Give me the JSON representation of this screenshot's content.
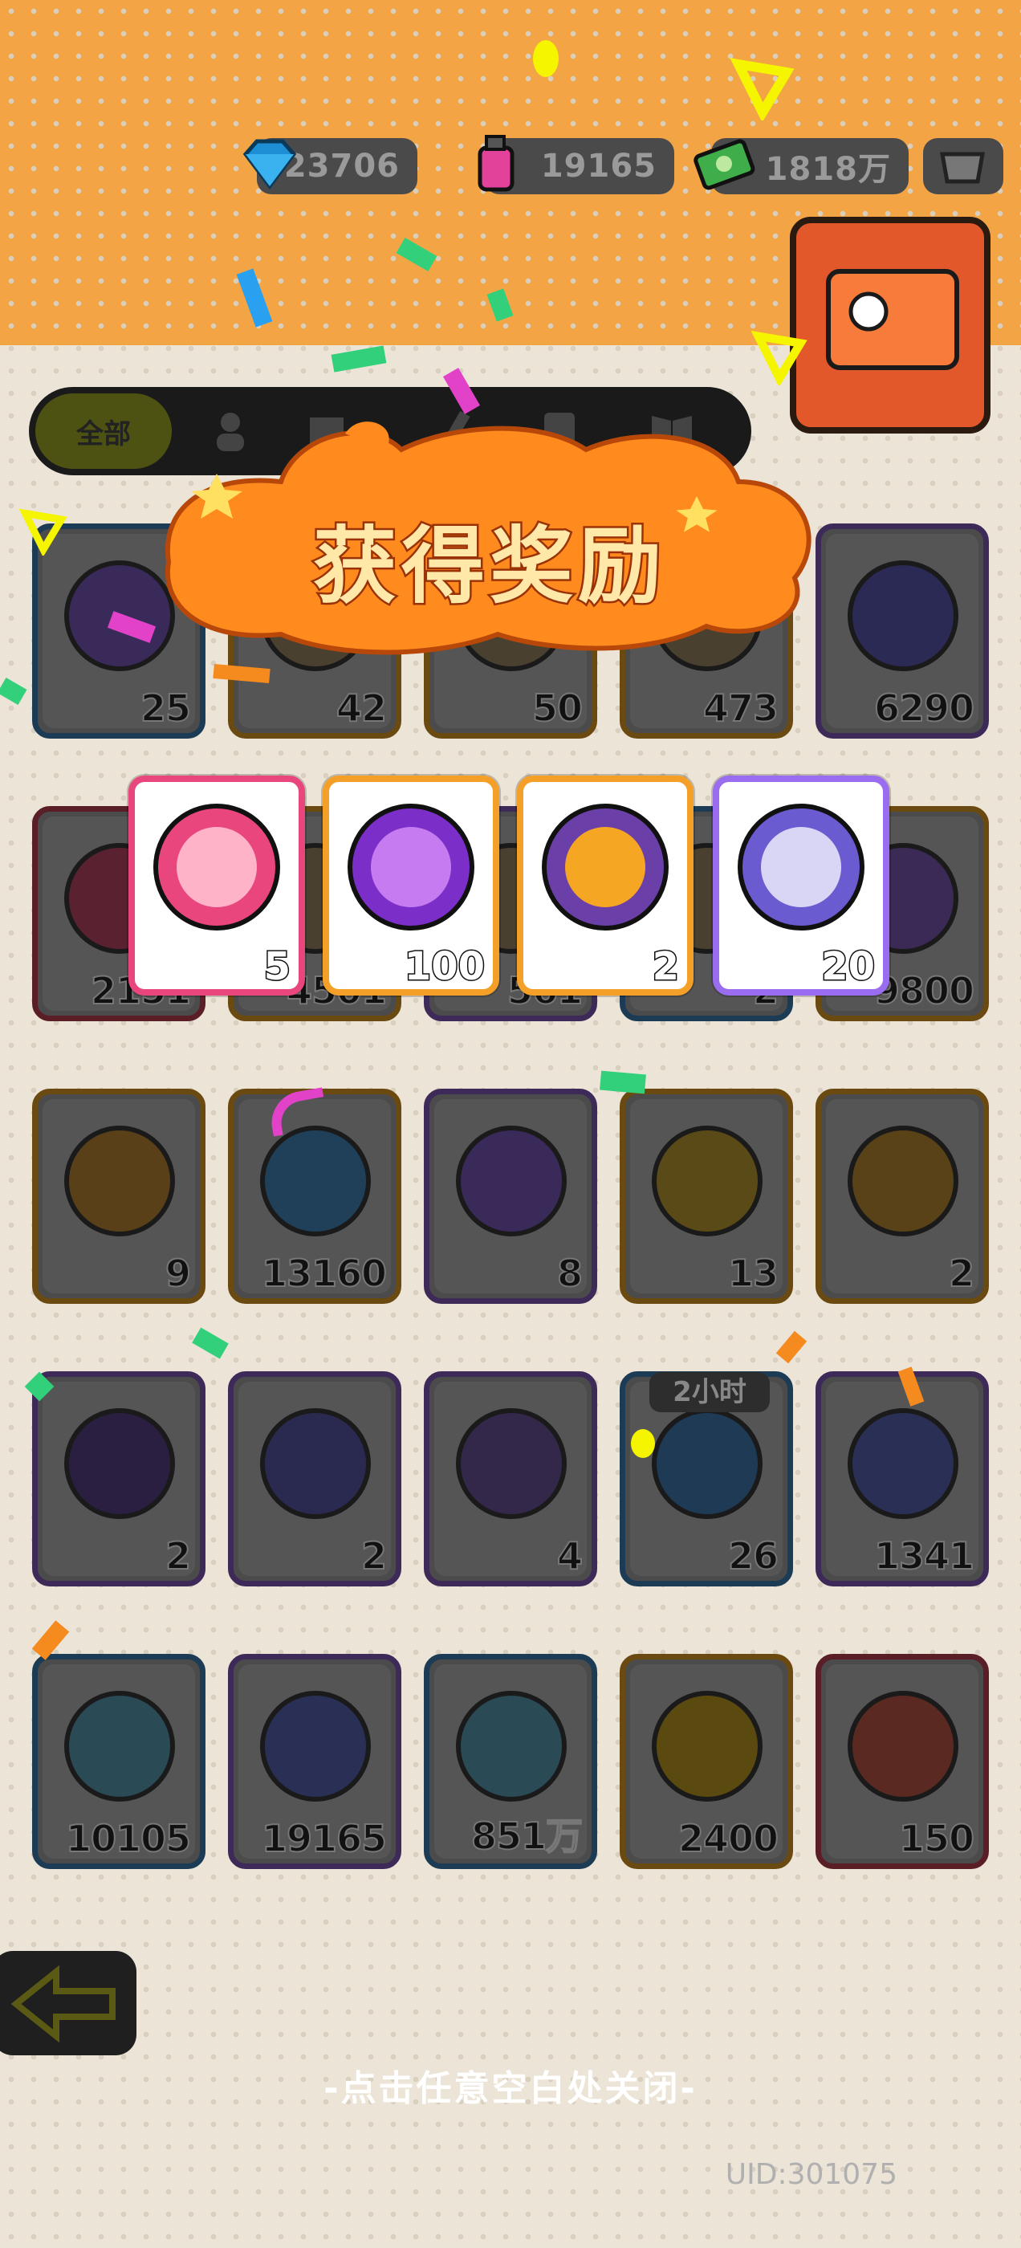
{
  "currencies": [
    {
      "icon": "diamond-icon",
      "value": "23706"
    },
    {
      "icon": "spray-can-icon",
      "value": "19165"
    },
    {
      "icon": "cash-icon",
      "value": "1818万"
    }
  ],
  "tabs": {
    "active_label": "全部"
  },
  "inventory": [
    {
      "icon": "ticket-icon",
      "count": "25",
      "border": "blue"
    },
    {
      "icon": "item-icon",
      "count": "42",
      "border": "orange"
    },
    {
      "icon": "item-icon",
      "count": "50",
      "border": "orange"
    },
    {
      "icon": "item-icon",
      "count": "473",
      "border": "orange"
    },
    {
      "icon": "dark-star-icon",
      "count": "6290",
      "border": "purple"
    },
    {
      "icon": "pencil-icon",
      "count": "2151",
      "border": "red"
    },
    {
      "icon": "item-icon",
      "count": "4501",
      "border": "orange"
    },
    {
      "icon": "item-icon",
      "count": "561",
      "border": "purple"
    },
    {
      "icon": "item-icon",
      "count": "2",
      "border": "blue"
    },
    {
      "icon": "cool-badge-icon",
      "count": "9800",
      "border": "orange"
    },
    {
      "icon": "star-coin-icon",
      "count": "9",
      "border": "orange"
    },
    {
      "icon": "ticket-fish-icon",
      "count": "13160",
      "border": "orange"
    },
    {
      "icon": "mystery-egg-icon",
      "count": "8",
      "border": "purple"
    },
    {
      "icon": "mystery-ticket-icon",
      "count": "13",
      "border": "orange"
    },
    {
      "icon": "grape-coin-icon",
      "count": "2",
      "border": "orange"
    },
    {
      "icon": "bat-coin-icon",
      "count": "2",
      "border": "purple"
    },
    {
      "icon": "fish-coin-icon",
      "count": "2",
      "border": "purple"
    },
    {
      "icon": "squid-coin-icon",
      "count": "4",
      "border": "purple"
    },
    {
      "icon": "alarm-clock-icon",
      "count": "26",
      "border": "blue",
      "timer": "2小时"
    },
    {
      "icon": "spray-can-icon",
      "count": "1341",
      "border": "purple"
    },
    {
      "icon": "paint-tube-icon",
      "count": "10105",
      "border": "blue"
    },
    {
      "icon": "spray-can-icon",
      "count": "19165",
      "border": "purple"
    },
    {
      "icon": "paint-tube-icon",
      "count": "851万",
      "border": "blue"
    },
    {
      "icon": "gold-star-icon",
      "count": "2400",
      "border": "orange"
    },
    {
      "icon": "red-star-icon",
      "count": "150",
      "border": "red"
    }
  ],
  "reward_popup": {
    "title": "获得奖励",
    "rewards": [
      {
        "icon": "pink-can-icon",
        "count": "5",
        "color": "#e8467c"
      },
      {
        "icon": "cool-badge-icon",
        "count": "100",
        "color": "#f4a028"
      },
      {
        "icon": "grape-coin-icon",
        "count": "2",
        "color": "#f4a028"
      },
      {
        "icon": "purple-can-icon",
        "count": "20",
        "color": "#9a6cf0"
      }
    ],
    "close_hint": "-点击任意空白处关闭-"
  },
  "footer": {
    "uid": "UID:301075"
  },
  "colors": {
    "accent": "#f39a22",
    "title_fill": "#ffe8a8",
    "panel_orange": "#ff8a1e"
  }
}
